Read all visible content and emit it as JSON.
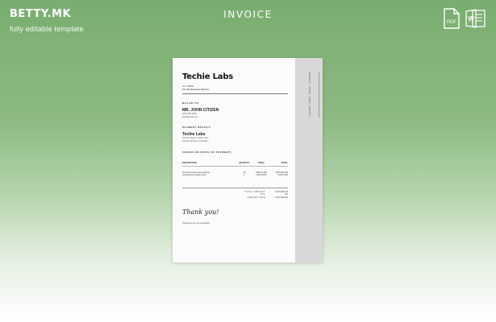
{
  "brand": {
    "title": "BETTY.MK",
    "subtitle": "fully editable template"
  },
  "page": {
    "heading": "INVOICE"
  },
  "file_icons": [
    {
      "name": "pdf-file-icon",
      "label": "PDF",
      "color": "#ffffff"
    },
    {
      "name": "word-file-icon",
      "label": "W",
      "color": "#ffffff"
    }
  ],
  "invoice": {
    "company": "Techie Labs",
    "invoice_no": "NO. 255896",
    "tagline": "The Top Business Services",
    "side_text": "ADDRESS · PHONE · EMAIL · WEBSITE",
    "billed_to": {
      "title": "BILLED TO",
      "name": "MR. JOHN CITIZEN",
      "line1": "(000) 000-0000",
      "line2": "john@email.com"
    },
    "payment": {
      "title": "PAYMENT DETAILS",
      "name": "Techie Labs",
      "line1": "Account Name: Techie Labs",
      "line2": "Account Number: 123-456-7"
    },
    "issue_date_title": "ISSUED ON [DATE OF PAYMENT]",
    "table": {
      "headers": [
        "DESCRIPTION",
        "QUANTITY",
        "PRICE",
        "TOTAL"
      ],
      "rows": [
        [
          "Technical setup and servicing",
          "40",
          "USD 12.500",
          "USD 400.000"
        ],
        [
          "Accessories programmed",
          "1",
          "USD 8.000",
          "USD 8.000"
        ]
      ]
    },
    "totals": [
      {
        "label": "TOTAL AMOUNT",
        "value": "USD 2000.00"
      },
      {
        "label": "TAX",
        "value": "0%"
      },
      {
        "label": "AMOUNT DUE",
        "value": "USD 2000.00"
      }
    ],
    "thanks": "Thank you!",
    "thanks_note": "Thank you for your purchase!"
  }
}
